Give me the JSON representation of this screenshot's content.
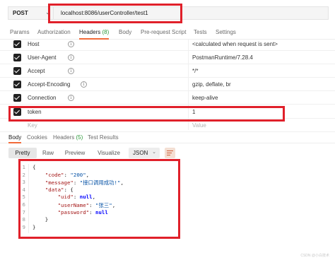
{
  "request": {
    "method": "POST",
    "url": "localhost:8086/userController/test1"
  },
  "request_tabs": [
    {
      "label": "Params"
    },
    {
      "label": "Authorization"
    },
    {
      "label": "Headers",
      "count": "(8)"
    },
    {
      "label": "Body"
    },
    {
      "label": "Pre-request Script"
    },
    {
      "label": "Tests"
    },
    {
      "label": "Settings"
    }
  ],
  "headers": [
    {
      "key": "Host",
      "value": "<calculated when request is sent>"
    },
    {
      "key": "User-Agent",
      "value": "PostmanRuntime/7.28.4"
    },
    {
      "key": "Accept",
      "value": "*/*"
    },
    {
      "key": "Accept-Encoding",
      "value": "gzip, deflate, br"
    },
    {
      "key": "Connection",
      "value": "keep-alive"
    },
    {
      "key": "token",
      "value": "1"
    }
  ],
  "headers_placeholder": {
    "key": "Key",
    "value": "Value"
  },
  "response_tabs": [
    {
      "label": "Body"
    },
    {
      "label": "Cookies"
    },
    {
      "label": "Headers",
      "count": "(5)"
    },
    {
      "label": "Test Results"
    }
  ],
  "format_options": [
    "Pretty",
    "Raw",
    "Preview",
    "Visualize"
  ],
  "format_select": "JSON",
  "response_body": {
    "line_numbers": [
      "1",
      "2",
      "3",
      "4",
      "5",
      "6",
      "7",
      "8",
      "9"
    ],
    "lines": [
      {
        "parts": [
          {
            "t": "{",
            "c": ""
          }
        ]
      },
      {
        "parts": [
          {
            "t": "    ",
            "c": ""
          },
          {
            "t": "\"code\"",
            "c": "k"
          },
          {
            "t": ": ",
            "c": ""
          },
          {
            "t": "\"200\"",
            "c": "s"
          },
          {
            "t": ",",
            "c": ""
          }
        ]
      },
      {
        "parts": [
          {
            "t": "    ",
            "c": ""
          },
          {
            "t": "\"message\"",
            "c": "k"
          },
          {
            "t": ": ",
            "c": ""
          },
          {
            "t": "\"接口调用成功!\"",
            "c": "s"
          },
          {
            "t": ",",
            "c": ""
          }
        ]
      },
      {
        "parts": [
          {
            "t": "    ",
            "c": ""
          },
          {
            "t": "\"data\"",
            "c": "k"
          },
          {
            "t": ": {",
            "c": ""
          }
        ]
      },
      {
        "parts": [
          {
            "t": "        ",
            "c": ""
          },
          {
            "t": "\"uid\"",
            "c": "k"
          },
          {
            "t": ": ",
            "c": ""
          },
          {
            "t": "null",
            "c": "n"
          },
          {
            "t": ",",
            "c": ""
          }
        ]
      },
      {
        "parts": [
          {
            "t": "        ",
            "c": ""
          },
          {
            "t": "\"userName\"",
            "c": "k"
          },
          {
            "t": ": ",
            "c": ""
          },
          {
            "t": "\"张三\"",
            "c": "s"
          },
          {
            "t": ",",
            "c": ""
          }
        ]
      },
      {
        "parts": [
          {
            "t": "        ",
            "c": ""
          },
          {
            "t": "\"password\"",
            "c": "k"
          },
          {
            "t": ": ",
            "c": ""
          },
          {
            "t": "null",
            "c": "n"
          }
        ]
      },
      {
        "parts": [
          {
            "t": "    }",
            "c": ""
          }
        ]
      },
      {
        "parts": [
          {
            "t": "}",
            "c": ""
          }
        ]
      }
    ]
  },
  "watermark": "CSDN @小白技术",
  "colors": {
    "accent": "#f26b3a",
    "highlight_box": "#e0202a",
    "count_green": "#2d9a3a"
  }
}
